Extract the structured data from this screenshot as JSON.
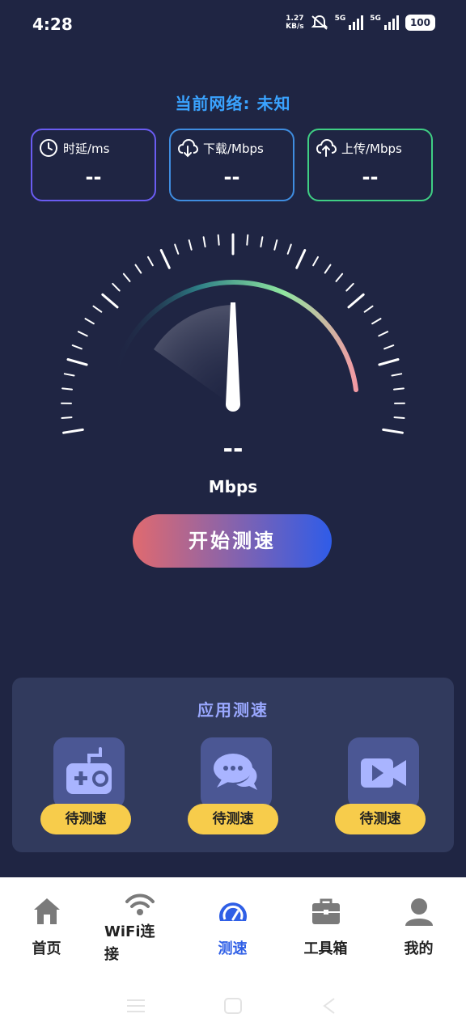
{
  "status": {
    "time": "4:28",
    "net_speed_top": "1.27",
    "net_speed_unit": "KB/s",
    "sim1": "5G",
    "sim2": "5G",
    "battery": "100"
  },
  "network": {
    "title": "当前网络: 未知"
  },
  "metrics": [
    {
      "label": "时延/ms",
      "value": "--",
      "icon": "clock-icon",
      "color": "#6a5cf2"
    },
    {
      "label": "下载/Mbps",
      "value": "--",
      "icon": "cloud-download-icon",
      "color": "#3f8de0"
    },
    {
      "label": "上传/Mbps",
      "value": "--",
      "icon": "cloud-upload-icon",
      "color": "#3fcf84"
    }
  ],
  "speed": {
    "value": "--",
    "unit": "Mbps"
  },
  "start_button": "开始测速",
  "app_test": {
    "title": "应用测速",
    "items": [
      {
        "icon": "gamepad-icon",
        "status": "待测速"
      },
      {
        "icon": "chat-icon",
        "status": "待测速"
      },
      {
        "icon": "video-icon",
        "status": "待测速"
      }
    ]
  },
  "tabs": [
    {
      "label": "首页",
      "icon": "home-icon"
    },
    {
      "label": "WiFi连接",
      "icon": "wifi-icon"
    },
    {
      "label": "测速",
      "icon": "speedometer-icon",
      "active": true
    },
    {
      "label": "工具箱",
      "icon": "toolbox-icon"
    },
    {
      "label": "我的",
      "icon": "user-icon"
    }
  ]
}
